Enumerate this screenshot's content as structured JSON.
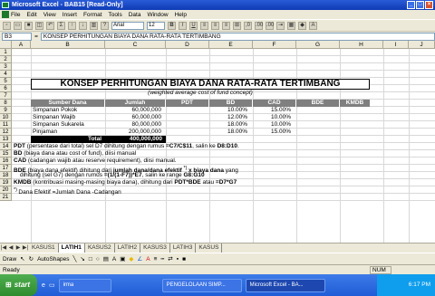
{
  "window": {
    "title": "Microsoft Excel - BAB15 [Read-Only]"
  },
  "menu": [
    "File",
    "Edit",
    "View",
    "Insert",
    "Format",
    "Tools",
    "Data",
    "Window",
    "Help"
  ],
  "toolbar": {
    "font": "Arial",
    "size": "12",
    "bold": "B",
    "italic": "I",
    "underline": "U",
    "fmt1": ",0",
    "fmt2": ".00",
    "fmt3": ".00"
  },
  "formula": {
    "namebox": "B3",
    "fx": "=",
    "content": "KONSEP PERHITUNGAN BIAYA DANA RATA-RATA TERTIMBANG"
  },
  "columns": [
    "A",
    "B",
    "C",
    "D",
    "E",
    "F",
    "G",
    "H",
    "I",
    "J"
  ],
  "rows": [
    "1",
    "2",
    "3",
    "4",
    "5",
    "6",
    "7",
    "8",
    "9",
    "10",
    "11",
    "12",
    "13",
    "14",
    "15",
    "16",
    "17",
    "18",
    "19",
    "20",
    "21"
  ],
  "sheet": {
    "title": "KONSEP PERHITUNGAN BIAYA DANA RATA-RATA TERTIMBANG",
    "subtitle": "(weighted average cost of fund concept)",
    "headers": [
      "Sumber Dana",
      "Jumlah",
      "PDT",
      "BD",
      "CAD",
      "BDE",
      "KMDB"
    ],
    "data": [
      {
        "name": "Simpanan Pokok",
        "jumlah": "60,000,000",
        "bd": "10.00%",
        "cad": "15.00%"
      },
      {
        "name": "Simpanan Wajib",
        "jumlah": "60,000,000",
        "bd": "12.00%",
        "cad": "10.00%"
      },
      {
        "name": "Simpanan Sukarela",
        "jumlah": "80,000,000",
        "bd": "18.00%",
        "cad": "10.00%"
      },
      {
        "name": "Pinjaman",
        "jumlah": "200,000,000",
        "bd": "18.00%",
        "cad": "15.00%"
      }
    ],
    "total_label": "Total",
    "total_value": "400,000,000",
    "notes": {
      "n12a": "PDT",
      "n12b": " (persentase dari total) sel D7 dihitung dengan rumus ",
      "n12c": "=C7/C$11",
      "n12d": ", salin ke ",
      "n12e": "D8:D10",
      "n12f": ".",
      "n13a": "BD",
      "n13b": " (biaya dana atau cost of fund), diisi manual",
      "n14a": "CAD",
      "n14b": " (cadangan wajib atau reserve requirement), diisi manual.",
      "n15a": "BDE",
      "n15b": " (biaya dana efektif) dihitung dari ",
      "n15c": "jumlah dana/dana efektif ",
      "n15d": "*) ",
      "n15e": "x biaya dana",
      "n15f": " yang",
      "n16a": "dihitung (sel G7) dengan rumus ",
      "n16b": "=(1/(1-F7))*E7",
      "n16c": ", salin ke range ",
      "n16d": "G8:G10",
      "n17a": "KMDB",
      "n17b": " (kontribuasi masing-masing biaya dana), dihitung dari ",
      "n17c": "PDT*BDE",
      "n17d": " atau ",
      "n17e": "=D7*G7",
      "n18a": "*) ",
      "n18b": "Dana Efektif =Jumlah Dana -Cadangan"
    }
  },
  "tabs": [
    "KASUS1",
    "LATIH1",
    "KASUS2",
    "LATIH2",
    "KASUS3",
    "LATIH3",
    "KASUS"
  ],
  "active_tab": "LATIH1",
  "drawbar": {
    "draw": "Draw",
    "autoshapes": "AutoShapes"
  },
  "status": {
    "ready": "Ready",
    "num": "NUM"
  },
  "taskbar": {
    "start": "start",
    "task1": "irma",
    "task2": "PENGELOLAAN SIMP...",
    "task3": "Microsoft Excel - BA...",
    "clock": "6:17 PM"
  },
  "colors": {
    "title_blue": "#0e3bb5",
    "header_gray": "#7f7f7f",
    "start_green": "#2e8b2e"
  }
}
